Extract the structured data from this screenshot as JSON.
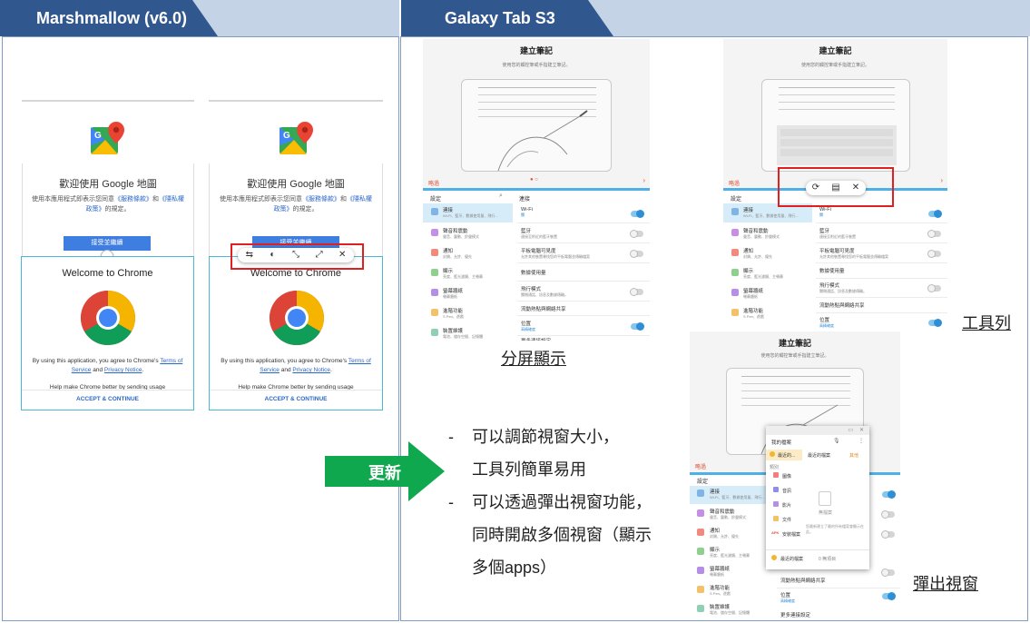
{
  "headers": {
    "left_tab": "Marshmallow (v6.0)",
    "right_tab": "Galaxy Tab S3"
  },
  "phones": [
    {
      "maps_title": "歡迎使用 Google 地圖",
      "maps_terms_pre": "使用本應用程式即表示您同意",
      "maps_terms_link1": "《服務條款》",
      "maps_terms_mid": "和",
      "maps_terms_link2": "《隱私權",
      "maps_terms_line2_link": "政策》",
      "maps_terms_line2_post": "的規定。",
      "maps_accept": "接受並繼續",
      "chrome_title": "Welcome to Chrome",
      "chrome_terms_pre": "By using this application, you agree to Chrome's ",
      "chrome_terms_link1": "Terms of Service",
      "chrome_terms_and": " and ",
      "chrome_terms_link2": "Privacy Notice",
      "chrome_terms_end": ".",
      "chrome_cut": "Help make Chrome better by sending usage",
      "chrome_accept": "ACCEPT & CONTINUE"
    },
    {
      "maps_title": "歡迎使用 Google 地圖",
      "maps_terms_pre": "使用本應用程式即表示您同意",
      "maps_terms_link1": "《服務條款》",
      "maps_terms_mid": "和",
      "maps_terms_link2": "《隱私權",
      "maps_terms_line2_link": "政策》",
      "maps_terms_line2_post": "的規定。",
      "maps_accept": "接受並繼續",
      "chrome_title": "Welcome to Chrome",
      "chrome_terms_pre": "By using this application, you agree to Chrome's ",
      "chrome_terms_link1": "Terms of Service",
      "chrome_terms_and": " and ",
      "chrome_terms_link2": "Privacy Notice",
      "chrome_terms_end": ".",
      "chrome_cut": "Help make Chrome better by sending usage",
      "chrome_accept": "ACCEPT & CONTINUE"
    }
  ],
  "toolbar_icons": [
    "swap-icon",
    "transparency-icon",
    "shrink-icon",
    "maximize-icon",
    "close-icon"
  ],
  "toolbar_glyphs": [
    "⇆",
    "◐",
    "⤡",
    "⤢",
    "✕"
  ],
  "tablet_toolbar_glyphs": [
    "⟳",
    "▤",
    "✕"
  ],
  "tablet": {
    "title": "建立筆記",
    "subtitle": "使用您的觸控筆或手指建立筆記。",
    "skip": "略過",
    "next_arrow": "›",
    "page_dots": "● ○",
    "settings_left_header": "設定",
    "settings_right_header": "連接",
    "left_items": [
      {
        "label": "連接",
        "sub": "Wi-Fi、藍牙、數據使用量、飛行..."
      },
      {
        "label": "聲音和震動",
        "sub": "聲音、震動、鈴聲模式"
      },
      {
        "label": "通知",
        "sub": "封鎖、允許、優先"
      },
      {
        "label": "顯示",
        "sub": "亮度、藍光濾鏡、主螢幕"
      },
      {
        "label": "螢幕牆紙",
        "sub": "螢幕牆紙"
      },
      {
        "label": "進階功能",
        "sub": "S Pen、遊戲"
      },
      {
        "label": "裝置維護",
        "sub": "電池、儲存空間、記憶體"
      }
    ],
    "right_items": [
      {
        "label": "Wi-Fi",
        "sub": "關"
      },
      {
        "label": "藍牙",
        "sub": "連接至附近的藍牙裝置"
      },
      {
        "label": "平板電腦可見度",
        "sub": "允許其他裝置尋找您的平板電腦並傳輸檔案"
      },
      {
        "label": "數據使用量",
        "sub": ""
      },
      {
        "label": "飛行模式",
        "sub": "關閉通話、訊息及數據傳輸。"
      },
      {
        "label": "流動熱點與網絡共享",
        "sub": ""
      },
      {
        "label": "位置",
        "sub": "高精確度"
      },
      {
        "label": "更多連接設定",
        "sub": ""
      }
    ]
  },
  "popup": {
    "header": "我的檔案",
    "recent_tab": "最近的...",
    "recent_files": "最近的檔案",
    "other_tab": "其他",
    "cat_label": "類別",
    "categories": [
      "圖像",
      "音訊",
      "影片",
      "文件",
      "安裝檔案"
    ],
    "no_files": "無檔案",
    "empty_note": "您最新建立了最的所有檔案會顯示在此。",
    "recent_storage": "最近的檔案",
    "storage_note": "0 無項目"
  },
  "captions": {
    "split": "分屏顯示",
    "toolbar": "工具列",
    "popup": "彈出視窗"
  },
  "update_label": "更新",
  "bullets": [
    {
      "dash": "-",
      "text": "可以調節視窗大小，"
    },
    {
      "dash": "",
      "text": "工具列簡單易用"
    },
    {
      "dash": "-",
      "text": "可以透過彈出視窗功能，"
    },
    {
      "dash": "",
      "text": "同時開啟多個視窗（顯示"
    },
    {
      "dash": "",
      "text": "多個apps）"
    }
  ],
  "colors": {
    "header_tab": "#31578f",
    "header_bar": "#c5d3e6",
    "update_arrow": "#0fa84f",
    "highlight_box": "#e02020"
  }
}
